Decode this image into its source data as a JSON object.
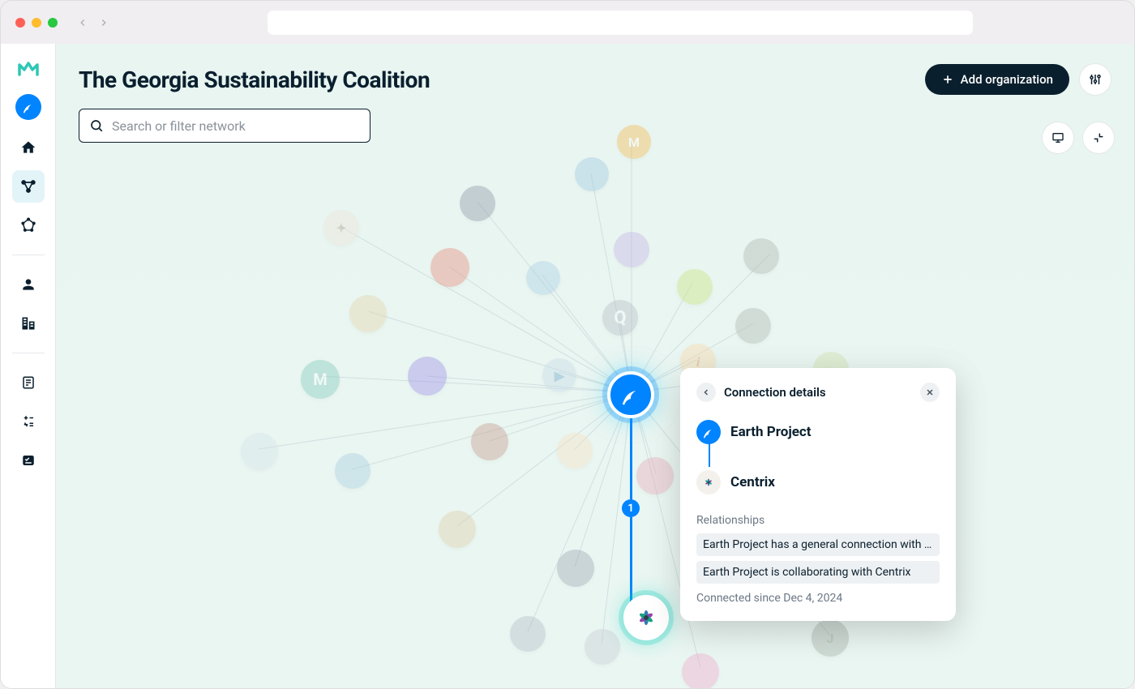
{
  "header": {
    "title": "The Georgia Sustainability Coalition",
    "add_label": "Add organization"
  },
  "search": {
    "placeholder": "Search or filter network"
  },
  "edge": {
    "badge": "1"
  },
  "popover": {
    "title": "Connection details",
    "org_a": "Earth Project",
    "org_b": "Centrix",
    "rel_label": "Relationships",
    "rel_1": "Earth Project has a general connection with Ce…",
    "rel_2": "Earth Project is collaborating with Centrix",
    "since": "Connected since Dec 4, 2024"
  },
  "nodes": {
    "earth": {
      "color": "#0084ff"
    },
    "centrix": {
      "color": "#ffffff"
    },
    "m": {
      "label": "M",
      "color": "#f5b84a"
    },
    "q": {
      "label": "Q",
      "color": "#a8b0b8"
    },
    "jambo": {
      "color": "#9fd35a"
    },
    "jj": {
      "color": "#9ca8a0"
    }
  },
  "colors": {
    "primary": "#0a1f2e",
    "accent": "#0084ff",
    "teal": "#2dc7b5"
  }
}
